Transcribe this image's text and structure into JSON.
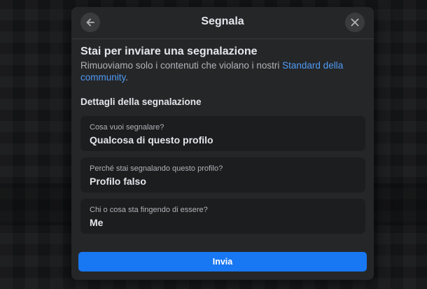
{
  "dialog": {
    "title": "Segnala",
    "back_icon": "arrow-left-icon",
    "close_icon": "close-icon"
  },
  "intro": {
    "heading": "Stai per inviare una segnalazione",
    "description": "Rimuoviamo solo i contenuti che violano i nostri ",
    "link": "Standard della community",
    "description_end": "."
  },
  "details": {
    "title": "Dettagli della segnalazione",
    "fields": [
      {
        "label": "Cosa vuoi segnalare?",
        "value": "Qualcosa di questo profilo"
      },
      {
        "label": "Perché stai segnalando questo profilo?",
        "value": "Profilo falso"
      },
      {
        "label": "Chi o cosa sta fingendo di essere?",
        "value": "Me"
      }
    ]
  },
  "actions": {
    "submit_label": "Invia"
  },
  "colors": {
    "accent": "#1877f2",
    "link": "#4e9bf5",
    "modal_bg": "#252628",
    "field_bg": "#1c1d1f"
  }
}
